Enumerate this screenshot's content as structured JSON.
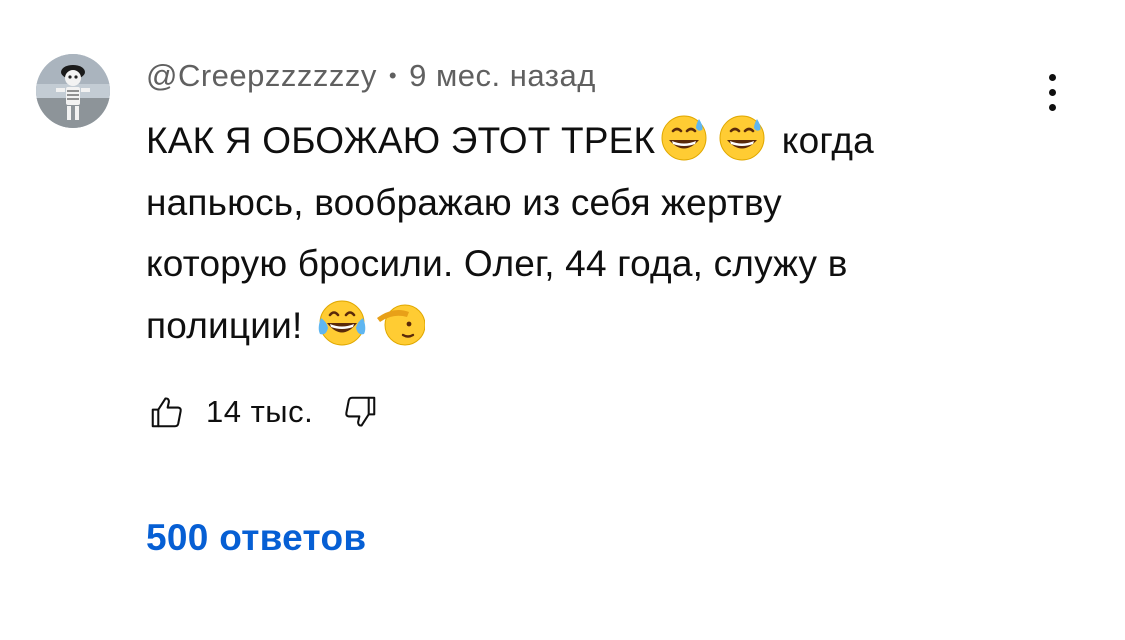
{
  "comment": {
    "author": "@Creepzzzzzzy",
    "separator": "•",
    "time": "9 мес. назад",
    "text_lines": {
      "l1a": "КАК Я ОБОЖАЮ ЭТОТ ТРЕК",
      "l1b": " когда",
      "l2": "напьюсь, воображаю из себя жертву",
      "l3": "которую бросили. Олег, 44 года, служу в",
      "l4": "полиции!"
    },
    "emoji_icons": [
      "grinning-sweat-icon",
      "grinning-sweat-icon",
      "tears-of-joy-icon",
      "saluting-face-icon"
    ],
    "like_count": "14 тыс.",
    "replies_label": "500 ответов"
  },
  "colors": {
    "text": "#0f0f0f",
    "meta": "#606060",
    "link": "#065fd4",
    "background": "#ffffff"
  }
}
